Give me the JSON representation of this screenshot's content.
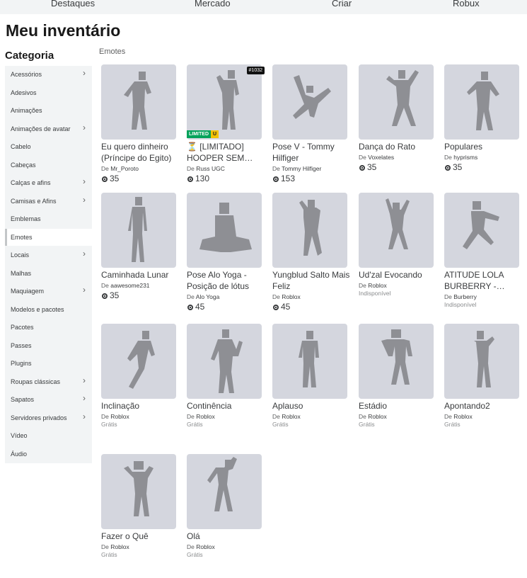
{
  "topnav": [
    "Destaques",
    "Mercado",
    "Criar",
    "Robux"
  ],
  "page_title": "Meu inventário",
  "category_title": "Categoria",
  "sidebar": [
    {
      "label": "Acessórios",
      "chevron": true
    },
    {
      "label": "Adesivos",
      "chevron": false
    },
    {
      "label": "Animações",
      "chevron": false
    },
    {
      "label": "Animações de avatar",
      "chevron": true
    },
    {
      "label": "Cabelo",
      "chevron": false
    },
    {
      "label": "Cabeças",
      "chevron": false
    },
    {
      "label": "Calças e afins",
      "chevron": true
    },
    {
      "label": "Camisas e Afins",
      "chevron": true
    },
    {
      "label": "Emblemas",
      "chevron": false
    },
    {
      "label": "Emotes",
      "chevron": false,
      "active": true
    },
    {
      "label": "Locais",
      "chevron": true
    },
    {
      "label": "Malhas",
      "chevron": false
    },
    {
      "label": "Maquiagem",
      "chevron": true
    },
    {
      "label": "Modelos e pacotes",
      "chevron": false
    },
    {
      "label": "Pacotes",
      "chevron": false
    },
    {
      "label": "Passes",
      "chevron": false
    },
    {
      "label": "Plugins",
      "chevron": false
    },
    {
      "label": "Roupas clássicas",
      "chevron": true
    },
    {
      "label": "Sapatos",
      "chevron": true
    },
    {
      "label": "Servidores privados",
      "chevron": true
    },
    {
      "label": "Vídeo",
      "chevron": false
    },
    {
      "label": "Áudio",
      "chevron": false
    }
  ],
  "section_label": "Emotes",
  "creator_prefix": "De",
  "items": [
    {
      "name": "Eu quero dinheiro (Príncipe do Egito)",
      "creator": "Mr_Poroto",
      "price": "35",
      "icon": "pose-icon"
    },
    {
      "name": "⏳ [LIMITADO] HOOPER SEM…",
      "creator": "Russ UGC",
      "price": "130",
      "serial": "#1032",
      "badge_limited": "LIMITED",
      "badge_u": "U",
      "icon": "pose-icon"
    },
    {
      "name": "Pose V - Tommy Hilfiger",
      "creator": "Tommy Hilfiger",
      "price": "153",
      "icon": "pose-icon"
    },
    {
      "name": "Dança do Rato",
      "creator": "Voxelates",
      "price": "35",
      "icon": "pose-icon"
    },
    {
      "name": "Populares",
      "creator": "hyprisms",
      "price": "35",
      "icon": "pose-icon"
    },
    {
      "name": "Caminhada Lunar",
      "creator": "aawesome231",
      "price": "35",
      "icon": "pose-icon"
    },
    {
      "name": "Pose Alo Yoga - Posição de lótus",
      "creator": "Alo Yoga",
      "price": "45",
      "icon": "pose-icon"
    },
    {
      "name": "Yungblud Salto Mais Feliz",
      "creator": "Roblox",
      "price": "45",
      "icon": "pose-icon"
    },
    {
      "name": "Ud'zal Evocando",
      "creator": "Roblox",
      "status": "Indisponível",
      "icon": "pose-icon"
    },
    {
      "name": "ATITUDE LOLA BURBERRY -…",
      "creator": "Burberry",
      "status": "Indisponível",
      "icon": "pose-icon"
    },
    {
      "name": "Inclinação",
      "creator": "Roblox",
      "status": "Grátis",
      "icon": "pose-icon"
    },
    {
      "name": "Continência",
      "creator": "Roblox",
      "status": "Grátis",
      "icon": "pose-icon"
    },
    {
      "name": "Aplauso",
      "creator": "Roblox",
      "status": "Grátis",
      "icon": "pose-icon"
    },
    {
      "name": "Estádio",
      "creator": "Roblox",
      "status": "Grátis",
      "icon": "pose-icon"
    },
    {
      "name": "Apontando2",
      "creator": "Roblox",
      "status": "Grátis",
      "icon": "pose-icon"
    },
    {
      "name": "Fazer o Quê",
      "creator": "Roblox",
      "status": "Grátis",
      "icon": "pose-icon"
    },
    {
      "name": "Olá",
      "creator": "Roblox",
      "status": "Grátis",
      "icon": "pose-icon"
    }
  ]
}
